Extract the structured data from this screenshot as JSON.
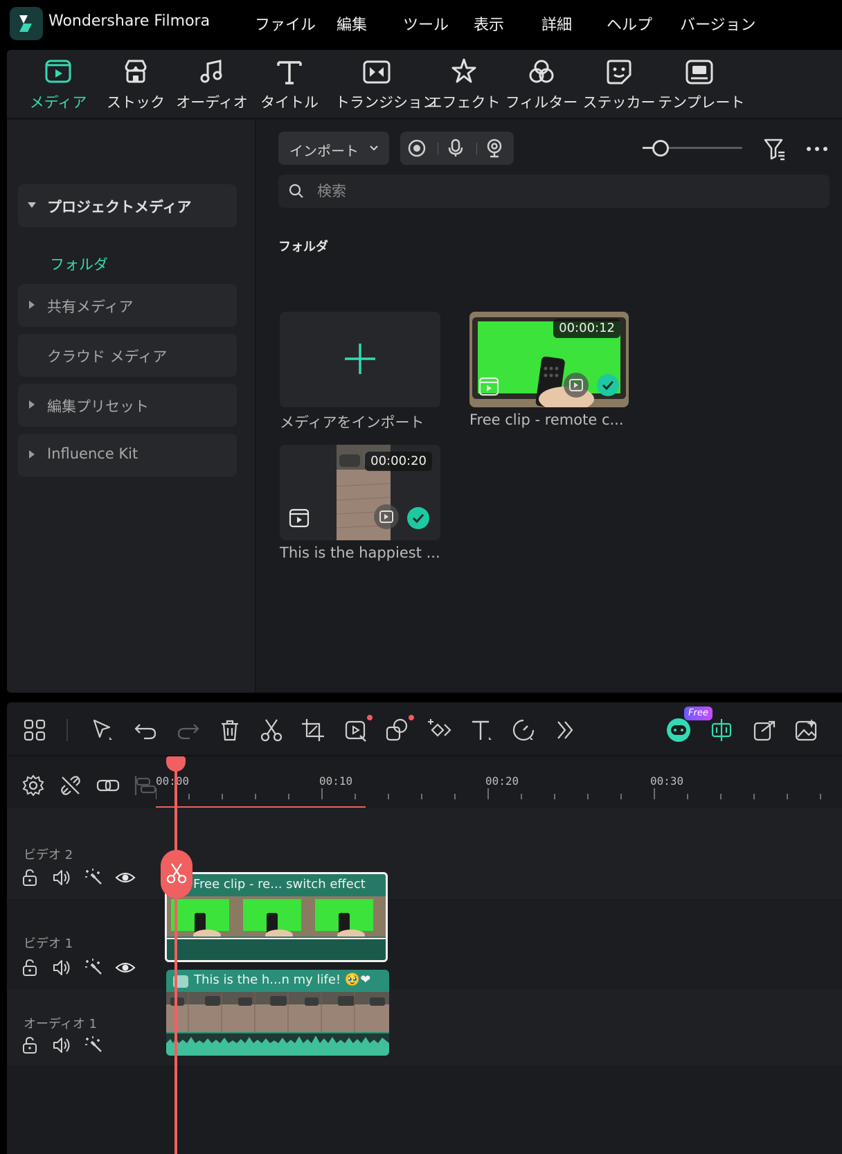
{
  "app": {
    "title": "Wondershare Filmora",
    "menu": [
      "ファイル",
      "編集",
      "ツール",
      "表示",
      "詳細",
      "ヘルプ",
      "バージョン"
    ]
  },
  "tabs": [
    {
      "label": "メディア",
      "icon": "media-icon",
      "active": true
    },
    {
      "label": "ストック",
      "icon": "stock-icon",
      "active": false
    },
    {
      "label": "オーディオ",
      "icon": "audio-icon",
      "active": false
    },
    {
      "label": "タイトル",
      "icon": "title-icon",
      "active": false
    },
    {
      "label": "トランジション",
      "icon": "transition-icon",
      "active": false
    },
    {
      "label": "エフェクト",
      "icon": "effect-icon",
      "active": false
    },
    {
      "label": "フィルター",
      "icon": "filter-icon",
      "active": false
    },
    {
      "label": "ステッカー",
      "icon": "sticker-icon",
      "active": false
    },
    {
      "label": "テンプレート",
      "icon": "template-icon",
      "active": false
    }
  ],
  "sidebar": {
    "project_media": "プロジェクトメディア",
    "folder": "フォルダ",
    "shared_media": "共有メディア",
    "cloud_media": "クラウド メディア",
    "edit_presets": "編集プリセット",
    "influence_kit": "Influence Kit"
  },
  "content": {
    "import_label": "インポート",
    "search_placeholder": "検索",
    "section_title": "フォルダ",
    "zoom_level": 0.18,
    "import_tile_caption": "メディアをインポート",
    "media": [
      {
        "caption": "Free clip - remote c...",
        "duration": "00:00:12"
      },
      {
        "caption": "This is the happiest ...",
        "duration": "00:00:20"
      }
    ]
  },
  "timeline": {
    "ruler": [
      "00:00",
      "00:10",
      "00:20",
      "00:30"
    ],
    "tracks": [
      {
        "name": "ビデオ 2",
        "clip_title": "Free clip - re... switch effect"
      },
      {
        "name": "ビデオ 1",
        "clip_title": "This is the h...n my life! 🥹❤"
      },
      {
        "name": "オーディオ 1"
      }
    ],
    "free_badge": "Free"
  },
  "colors": {
    "accent": "#35d9b2",
    "playhead": "#f06060",
    "clip_teal": "#2a8f78",
    "panel_bg": "#1b1c1f"
  }
}
